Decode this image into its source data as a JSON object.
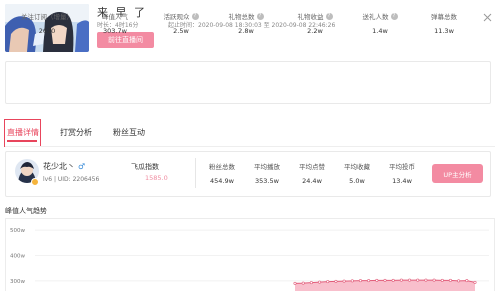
{
  "header": {
    "title": "来 早 了",
    "duration": "时长：4时16分",
    "time_range": "起止时间：2020-09-08 18:30:03 至 2020-09-08 22:46:26",
    "go_button": "前往直播间"
  },
  "stats": [
    {
      "label": "关注订阅（增量）",
      "value": "2610",
      "help": false
    },
    {
      "label": "峰值人气",
      "value": "303.7w",
      "help": false
    },
    {
      "label": "活跃观众",
      "value": "2.5w",
      "help": true
    },
    {
      "label": "礼物总数",
      "value": "2.8w",
      "help": true
    },
    {
      "label": "礼物收益",
      "value": "2.2w",
      "help": true
    },
    {
      "label": "送礼人数",
      "value": "1.4w",
      "help": true
    },
    {
      "label": "弹幕总数",
      "value": "11.3w",
      "help": false
    }
  ],
  "tabs": [
    "直播详情",
    "打赏分析",
    "粉丝互动"
  ],
  "anchor": {
    "name": "花少北丶",
    "gender_symbol": "♂",
    "info": "lv6 | UID: 2206456",
    "melon_label": "飞瓜指数",
    "melon_value": "1585.0",
    "metrics": [
      {
        "label": "粉丝总数",
        "value": "454.9w"
      },
      {
        "label": "平均播放",
        "value": "353.5w"
      },
      {
        "label": "平均点赞",
        "value": "24.4w"
      },
      {
        "label": "平均收藏",
        "value": "5.0w"
      },
      {
        "label": "平均投币",
        "value": "13.4w"
      }
    ],
    "up_button": "UP主分析"
  },
  "chart_data": {
    "type": "area",
    "title": "峰值人气趋势",
    "yticks": [
      "500w",
      "400w",
      "300w"
    ],
    "ylim": [
      260,
      540
    ],
    "values": [
      290,
      291,
      293,
      295,
      297,
      298,
      299,
      300,
      301,
      301,
      302,
      302,
      302,
      303,
      303,
      303,
      303,
      303,
      302,
      302,
      300,
      301,
      294
    ],
    "color": "#f38ba2"
  },
  "colors": {
    "accent": "#e8455c",
    "button": "#f38ba2"
  }
}
